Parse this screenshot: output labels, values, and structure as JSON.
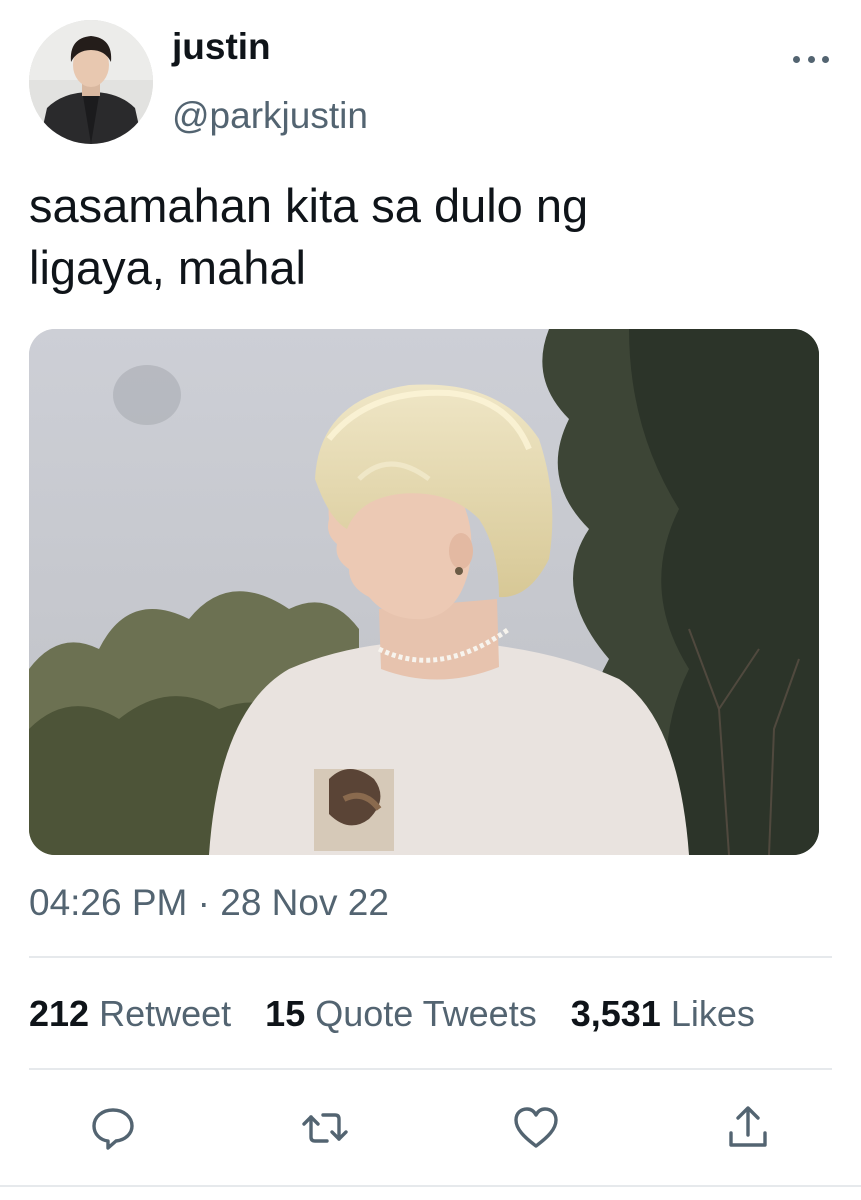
{
  "author": {
    "display_name": "justin",
    "handle": "@parkjustin"
  },
  "tweet": {
    "text_line1": "sasamahan kita sa dulo ng",
    "text_line2": "ligaya, mahal",
    "timestamp": "04:26 PM · 28 Nov 22"
  },
  "stats": {
    "retweets_count": "212",
    "retweets_label": "Retweet",
    "quotes_count": "15",
    "quotes_label": "Quote Tweets",
    "likes_count": "3,531",
    "likes_label": "Likes"
  },
  "icons": {
    "more": "more-horizontal-icon",
    "reply": "reply-icon",
    "retweet": "retweet-icon",
    "like": "heart-icon",
    "share": "share-icon"
  },
  "colors": {
    "text_primary": "#0f1419",
    "text_secondary": "#536471",
    "divider": "#e6e9ec"
  }
}
